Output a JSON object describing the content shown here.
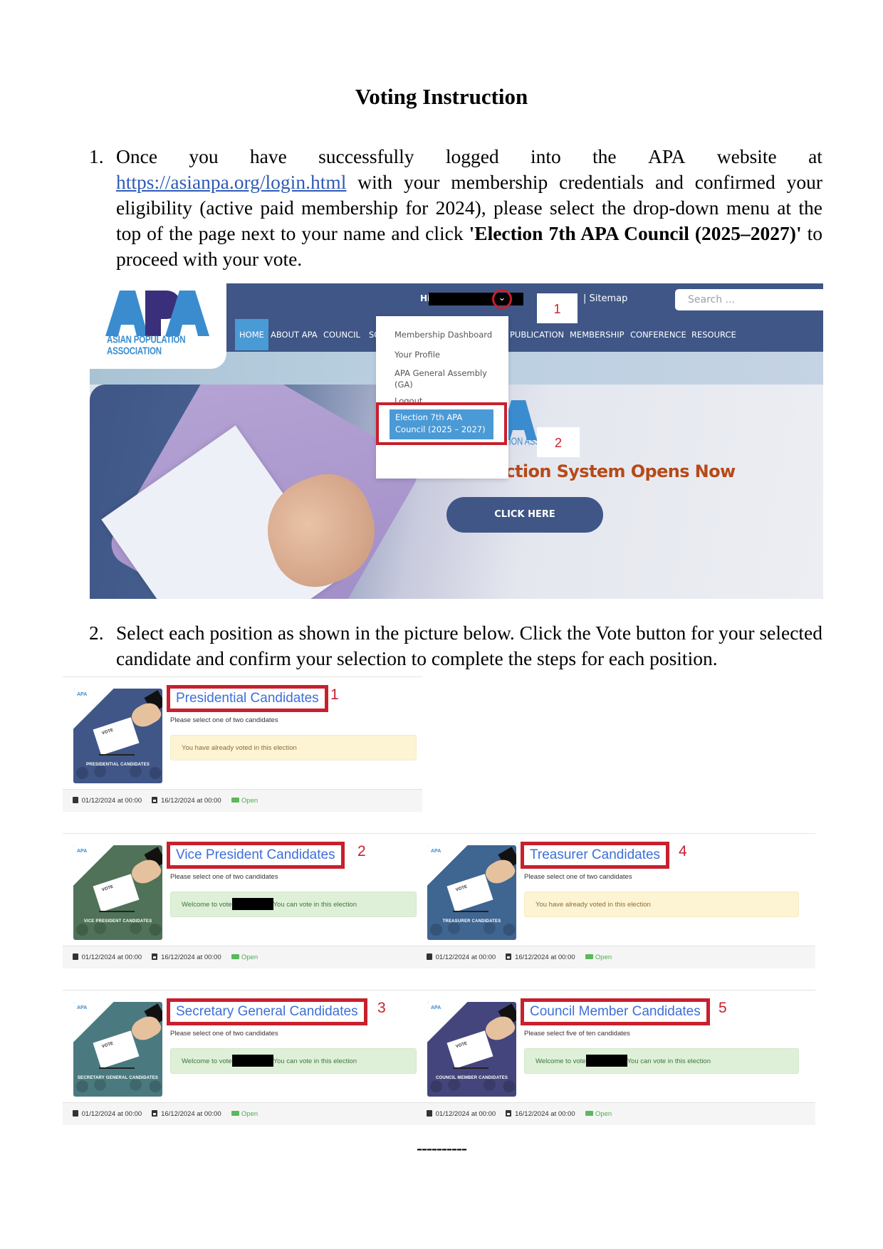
{
  "document": {
    "title": "Voting Instruction",
    "step1": {
      "number": "1.",
      "words_line1": [
        "Once",
        "you",
        "have",
        "successfully",
        "logged",
        "into",
        "the",
        "APA",
        "website",
        "at"
      ],
      "link": "https://asianpa.org/login.html",
      "text_after_link": " with your membership credentials and confirmed your eligibility (active paid membership for 2024), please select the drop-down menu at the top of the page next to your name and click ",
      "bold": "'Election 7th APA Council (2025–2027)'",
      "text_end": " to proceed with your vote."
    },
    "step2": {
      "number": "2.",
      "text": "Select each position as shown in the picture below. Click the Vote button for your selected candidate and confirm your selection to complete the steps for each position."
    },
    "end_marker": "----------"
  },
  "screenshot1": {
    "logo": {
      "letters": "APA",
      "tagline": "ASIAN POPULATION ASSOCIATION"
    },
    "greeting": "Hi",
    "chevron_icon": "chevron-down-icon",
    "callout_1": "1",
    "callout_2": "2",
    "sitemap": "| Sitemap",
    "search_placeholder": "Search ...",
    "nav": [
      "HOME",
      "ABOUT APA",
      "COUNCIL",
      "SO",
      "PUBLICATION",
      "MEMBERSHIP",
      "CONFERENCE",
      "RESOURCE"
    ],
    "dropdown": {
      "items": [
        "Membership Dashboard",
        "Your Profile",
        "APA General Assembly (GA)",
        "Logout"
      ],
      "highlighted": "Election 7th APA Council (2025 – 2027)"
    },
    "hero": {
      "logo_tagline": "ASIAN POPULATION ASSOCIATION",
      "headline": "An Election System Opens Now",
      "cta": "CLICK HERE"
    },
    "colors": {
      "nav_bar": "#3f5687",
      "active_nav": "#4a9ad6",
      "highlight_red": "#c8202d",
      "headline": "#b64a17"
    }
  },
  "elections": [
    {
      "step": "1",
      "title": "Presidential Candidates",
      "thumb_caption": "PRESIDENTIAL CANDIDATES",
      "thumb_color": "#3f5687",
      "subtitle": "Please select one of two candidates",
      "status_type": "warn",
      "status": "You have already voted in this election",
      "start": "01/12/2024 at 00:00",
      "end": "16/12/2024 at 00:00",
      "state": "Open"
    },
    {
      "step": "2",
      "title": "Vice President Candidates",
      "thumb_caption": "VICE PRESIDENT CANDIDATES",
      "thumb_color": "#4f7258",
      "subtitle": "Please select one of two candidates",
      "status_type": "ok",
      "status_prefix": "Welcome to vote",
      "status": "You can vote in this election",
      "start": "01/12/2024 at 00:00",
      "end": "16/12/2024 at 00:00",
      "state": "Open"
    },
    {
      "step": "4",
      "title": "Treasurer Candidates",
      "thumb_caption": "TREASURER CANDIDATES",
      "thumb_color": "#3f6591",
      "subtitle": "Please select one of two candidates",
      "status_type": "warn",
      "status": "You have already voted in this election",
      "start": "01/12/2024 at 00:00",
      "end": "16/12/2024 at 00:00",
      "state": "Open"
    },
    {
      "step": "3",
      "title": "Secretary General Candidates",
      "thumb_caption": "SECRETARY GENERAL CANDIDATES",
      "thumb_color": "#4a7a80",
      "subtitle": "Please select one of two candidates",
      "status_type": "ok",
      "status_prefix": "Welcome to vote",
      "status": "You can vote in this election",
      "start": "01/12/2024 at 00:00",
      "end": "16/12/2024 at 00:00",
      "state": "Open"
    },
    {
      "step": "5",
      "title": "Council Member Candidates",
      "thumb_caption": "COUNCIL MEMBER CANDIDATES",
      "thumb_color": "#45457d",
      "subtitle": "Please select five of ten candidates",
      "status_type": "ok",
      "status_prefix": "Welcome to vote",
      "status": "You can vote in this election",
      "start": "01/12/2024 at 00:00",
      "end": "16/12/2024 at 00:00",
      "state": "Open"
    }
  ]
}
